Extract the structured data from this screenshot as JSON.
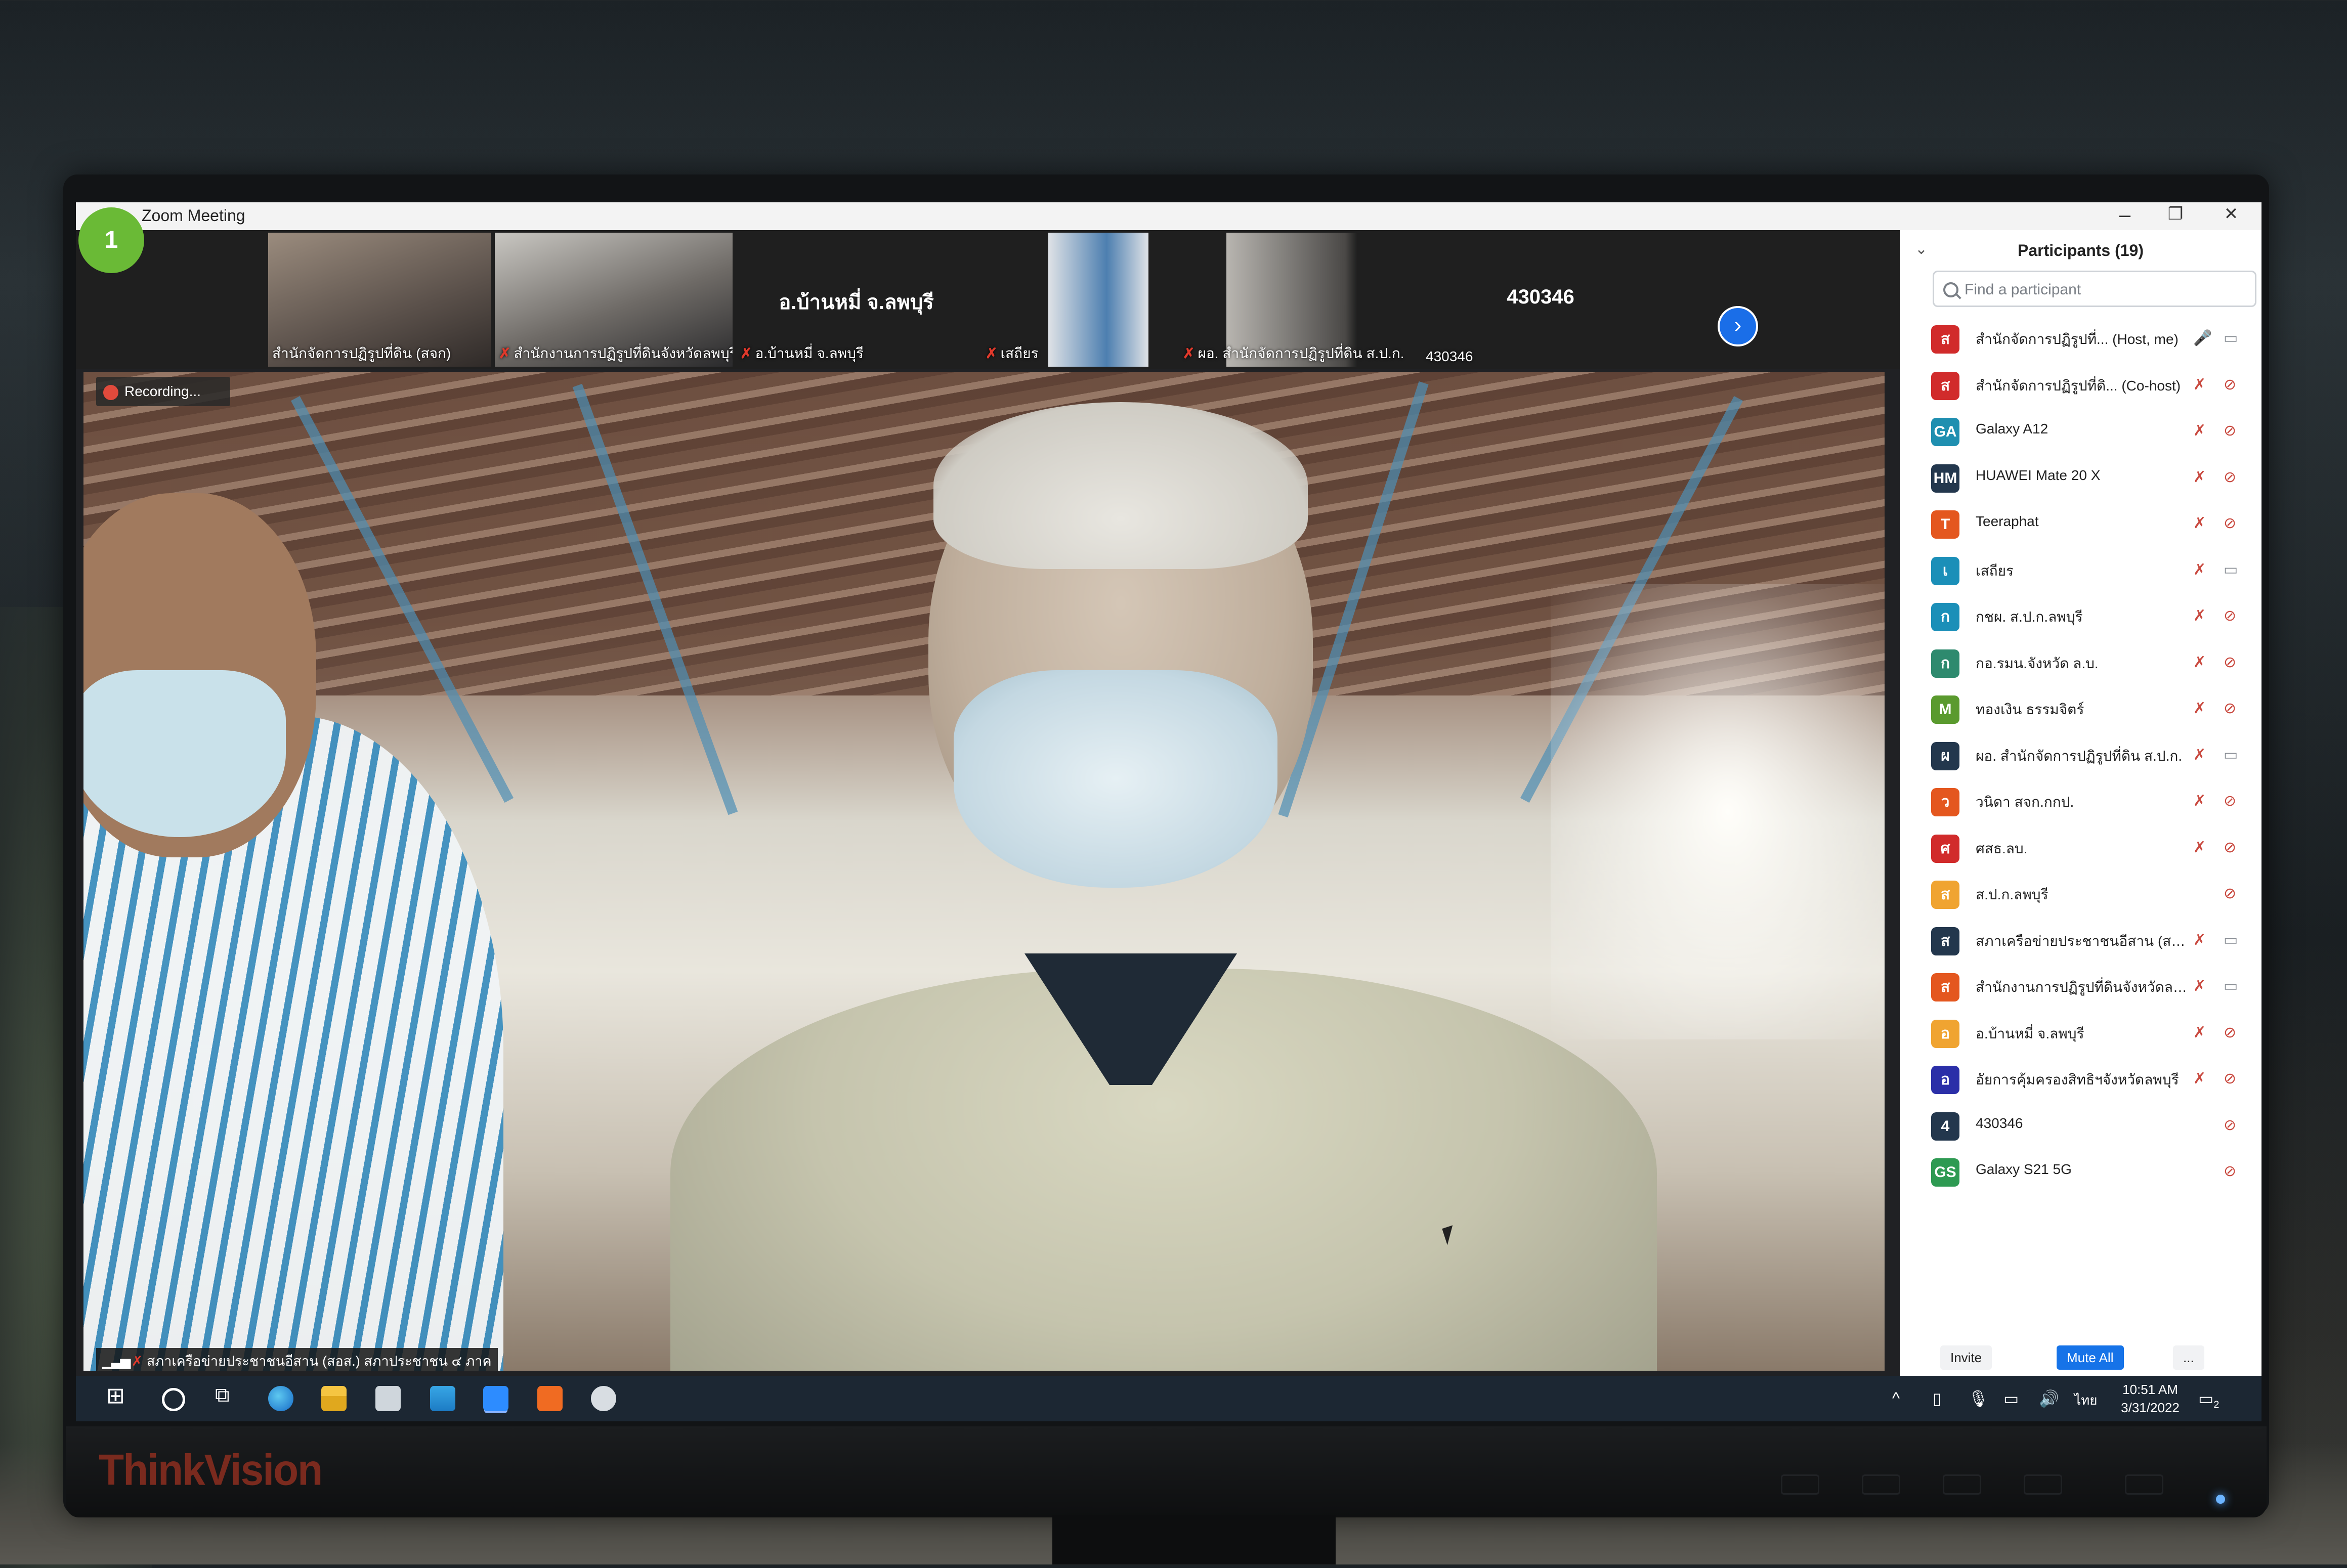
{
  "window": {
    "title": "Zoom Meeting",
    "badge_count": "1",
    "controls": [
      "–",
      "❐",
      "✕"
    ]
  },
  "gallery_strip": {
    "tiles": [
      {
        "label": "สำนักจัดการปฏิรูปที่ดิน (สจก)",
        "muted": false,
        "has_video": true
      },
      {
        "label": "สำนักงานการปฏิรูปที่ดินจังหวัดลพบุรี",
        "muted": true,
        "has_video": true
      },
      {
        "label": "อ.บ้านหมี่ จ.ลพบุรี",
        "muted": true,
        "has_video": false,
        "display_name": "อ.บ้านหมี่ จ.ลพบุรี"
      },
      {
        "label": "เสถียร",
        "muted": true,
        "has_video": true
      },
      {
        "label": "ผอ. สำนักจัดการปฏิรูปที่ดิน ส.ป.ก.",
        "muted": true,
        "has_video": true
      },
      {
        "label": "430346",
        "muted": false,
        "has_video": false,
        "display_name": "430346"
      }
    ],
    "next_icon": "›"
  },
  "main_video": {
    "recording_label": "Recording...",
    "speaker_label": "สภาเครือข่ายประชาชนอีสาน (สอส.) สภาประชาชน ๔ ภาค"
  },
  "participants_panel": {
    "title": "Participants (19)",
    "search_placeholder": "Find a participant",
    "participants": [
      {
        "initials": "ส",
        "name": "สำนักจัดการปฏิรูปที่... (Host, me)",
        "color": "#d12b2b",
        "mic": "mic-on-icon",
        "cam": "camera-on-icon"
      },
      {
        "initials": "ส",
        "name": "สำนักจัดการปฏิรูปที่ดิ... (Co-host)",
        "color": "#d12b2b",
        "mic": "mic-muted-icon",
        "cam": "camera-off-icon"
      },
      {
        "initials": "GA",
        "name": "Galaxy A12",
        "color": "#1f8fb0",
        "mic": "mic-muted-icon",
        "cam": "camera-off-icon"
      },
      {
        "initials": "HM",
        "name": "HUAWEI Mate 20 X",
        "color": "#23374d",
        "mic": "mic-muted-icon",
        "cam": "camera-off-icon"
      },
      {
        "initials": "T",
        "name": "Teeraphat",
        "color": "#e4571f",
        "mic": "mic-muted-icon",
        "cam": "camera-off-icon"
      },
      {
        "initials": "เ",
        "name": "เสถียร",
        "color": "#1b8fb8",
        "mic": "mic-muted-icon",
        "cam": "camera-on-icon"
      },
      {
        "initials": "ก",
        "name": "กชผ. ส.ป.ก.ลพบุรี",
        "color": "#1b8fb8",
        "mic": "mic-muted-icon",
        "cam": "camera-off-icon"
      },
      {
        "initials": "ก",
        "name": "กอ.รมน.จังหวัด ล.บ.",
        "color": "#2e8a6e",
        "mic": "mic-muted-icon",
        "cam": "camera-off-icon"
      },
      {
        "initials": "M",
        "name": "ทองเงิน ธรรมจิตร์",
        "color": "#5a9a2e",
        "mic": "mic-muted-icon",
        "cam": "camera-off-icon"
      },
      {
        "initials": "ผ",
        "name": "ผอ. สำนักจัดการปฏิรูปที่ดิน ส.ป.ก.",
        "color": "#23374d",
        "mic": "mic-muted-icon",
        "cam": "camera-on-icon"
      },
      {
        "initials": "ว",
        "name": "วนิดา สจก.กกป.",
        "color": "#e4571f",
        "mic": "mic-muted-icon",
        "cam": "camera-off-icon"
      },
      {
        "initials": "ศ",
        "name": "ศสธ.ลบ.",
        "color": "#d12b2b",
        "mic": "mic-muted-icon",
        "cam": "camera-off-icon"
      },
      {
        "initials": "ส",
        "name": "ส.ป.ก.ลพบุรี",
        "color": "#f0a431",
        "mic": "",
        "cam": "camera-off-icon"
      },
      {
        "initials": "ส",
        "name": "สภาเครือข่ายประชาชนอีสาน (สอส.) ส...",
        "color": "#23374d",
        "mic": "mic-muted-icon",
        "cam": "camera-on-icon"
      },
      {
        "initials": "ส",
        "name": "สำนักงานการปฏิรูปที่ดินจังหวัดลพบุรี",
        "color": "#e4571f",
        "mic": "mic-muted-icon",
        "cam": "camera-on-icon"
      },
      {
        "initials": "อ",
        "name": "อ.บ้านหมี่ จ.ลพบุรี",
        "color": "#f0a431",
        "mic": "mic-muted-icon",
        "cam": "camera-off-icon"
      },
      {
        "initials": "อ",
        "name": "อัยการคุ้มครองสิทธิฯจังหวัดลพบุรี",
        "color": "#2b2fa8",
        "mic": "mic-muted-icon",
        "cam": "camera-off-icon"
      },
      {
        "initials": "4",
        "name": "430346",
        "color": "#23374d",
        "mic": "",
        "cam": "camera-off-icon"
      },
      {
        "initials": "GS",
        "name": "Galaxy S21 5G",
        "color": "#2e9a52",
        "mic": "",
        "cam": "camera-off-icon"
      }
    ],
    "footer": {
      "invite": "Invite",
      "mute_all": "Mute All",
      "more": "..."
    }
  },
  "taskbar": {
    "time": "10:51 AM",
    "date": "3/31/2022",
    "language": "ไทย",
    "notification_count": "2",
    "tray_up": "^"
  },
  "monitor": {
    "brand": "ThinkVision"
  }
}
